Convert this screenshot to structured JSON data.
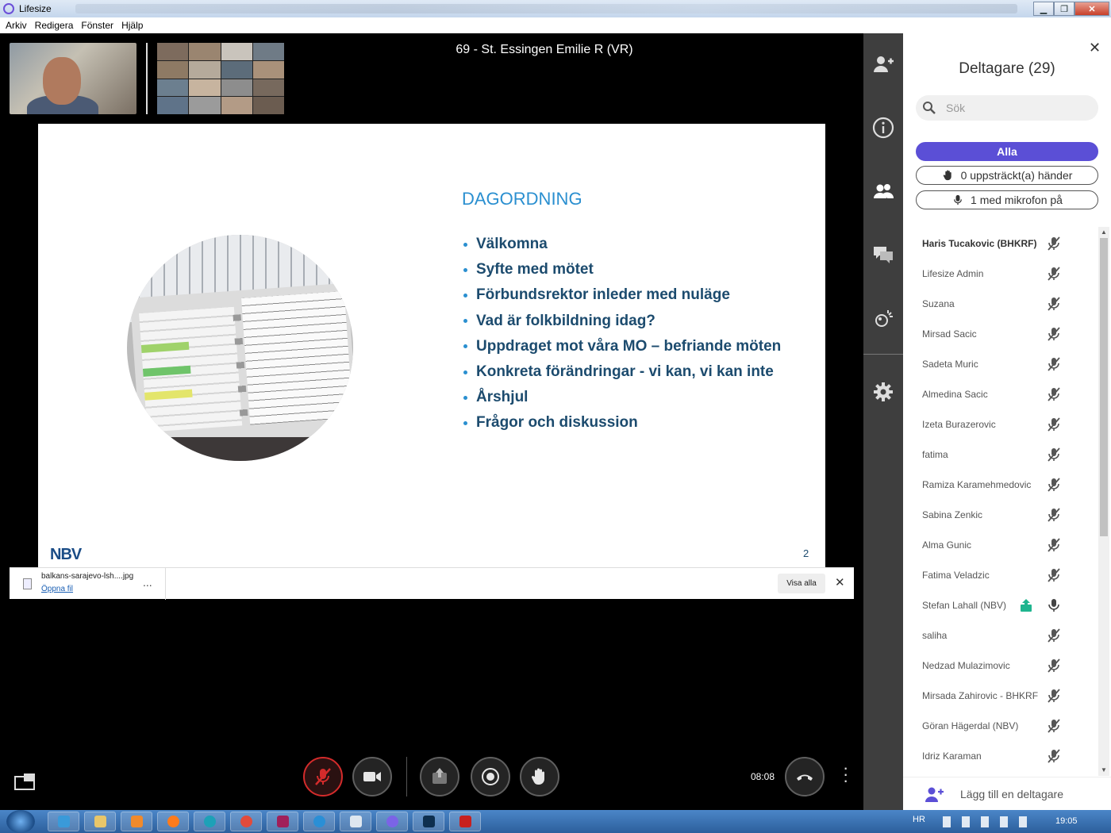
{
  "window": {
    "title": "Lifesize"
  },
  "menu": [
    "Arkiv",
    "Redigera",
    "Fönster",
    "Hjälp"
  ],
  "meeting": {
    "title": "69 - St. Essingen Emilie R (VR)"
  },
  "slide": {
    "heading": "DAGORDNING",
    "items": [
      "Välkomna",
      "Syfte med mötet",
      "Förbundsrektor inleder med nuläge",
      "Vad är folkbildning idag?",
      "Uppdraget mot våra MO – befriande möten",
      "Konkreta förändringar - vi kan, vi kan inte",
      "Årshjul",
      "Frågor och diskussion"
    ],
    "logo": "NBV",
    "page_number": "2"
  },
  "download": {
    "file_name": "balkans-sarajevo-lsh....jpg",
    "open_label": "Öppna fil",
    "more": "...",
    "show_all": "Visa alla",
    "close": "✕"
  },
  "controls": {
    "timer": "08:08"
  },
  "panel": {
    "close": "✕",
    "title": "Deltagare (29)",
    "search_placeholder": "Sök",
    "filter_all": "Alla",
    "filter_hands": "0 uppsträckt(a) händer",
    "filter_mics": "1 med mikrofon på",
    "add_participant": "Lägg till en deltagare",
    "participants": [
      {
        "name": "Haris Tucakovic (BHKRF)",
        "muted": true,
        "bold": true
      },
      {
        "name": "Lifesize Admin",
        "muted": true
      },
      {
        "name": "Suzana",
        "muted": true
      },
      {
        "name": "Mirsad Sacic",
        "muted": true
      },
      {
        "name": "Sadeta Muric",
        "muted": true
      },
      {
        "name": "Almedina Sacic",
        "muted": true
      },
      {
        "name": "Izeta Burazerovic",
        "muted": true
      },
      {
        "name": "fatima",
        "muted": true
      },
      {
        "name": "Ramiza Karamehmedovic",
        "muted": true
      },
      {
        "name": "Sabina Zenkic",
        "muted": true
      },
      {
        "name": "Alma Gunic",
        "muted": true
      },
      {
        "name": "Fatima Veladzic",
        "muted": true
      },
      {
        "name": "Stefan Lahall (NBV)",
        "muted": false,
        "sharing": true
      },
      {
        "name": "saliha",
        "muted": true
      },
      {
        "name": "Nedzad Mulazimovic",
        "muted": true
      },
      {
        "name": "Mirsada Zahirovic - BHKRF",
        "muted": true
      },
      {
        "name": "Göran Hägerdal (NBV)",
        "muted": true
      },
      {
        "name": "Idriz Karaman",
        "muted": true
      }
    ]
  },
  "taskbar": {
    "language": "HR",
    "clock": "19:05"
  },
  "colors": {
    "accent": "#5b4fd6",
    "mic_muted_ring": "#d32b2b",
    "slide_heading": "#2a8fd0",
    "slide_text": "#1c4b6e"
  }
}
